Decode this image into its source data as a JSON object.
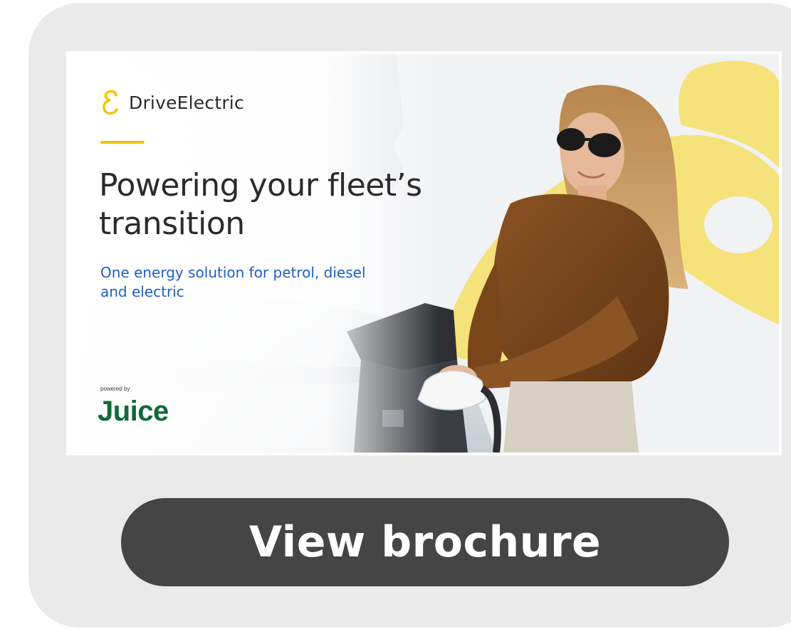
{
  "banner": {
    "brand": {
      "name": "DriveElectric",
      "icon": "driveelectric-logo-icon",
      "accent_color": "#f2c500"
    },
    "headline": "Powering your fleet’s transition",
    "subheadline": "One energy solution for petrol, diesel and electric",
    "powered_by_label": "powered by",
    "partner_logo_text": "Juice",
    "colors": {
      "headline": "#2b2b2b",
      "subheadline": "#1f5fc6",
      "partner": "#0d6b3a",
      "decor_yellow": "#f6e27a"
    }
  },
  "cta": {
    "label": "View brochure",
    "background": "#454545"
  }
}
